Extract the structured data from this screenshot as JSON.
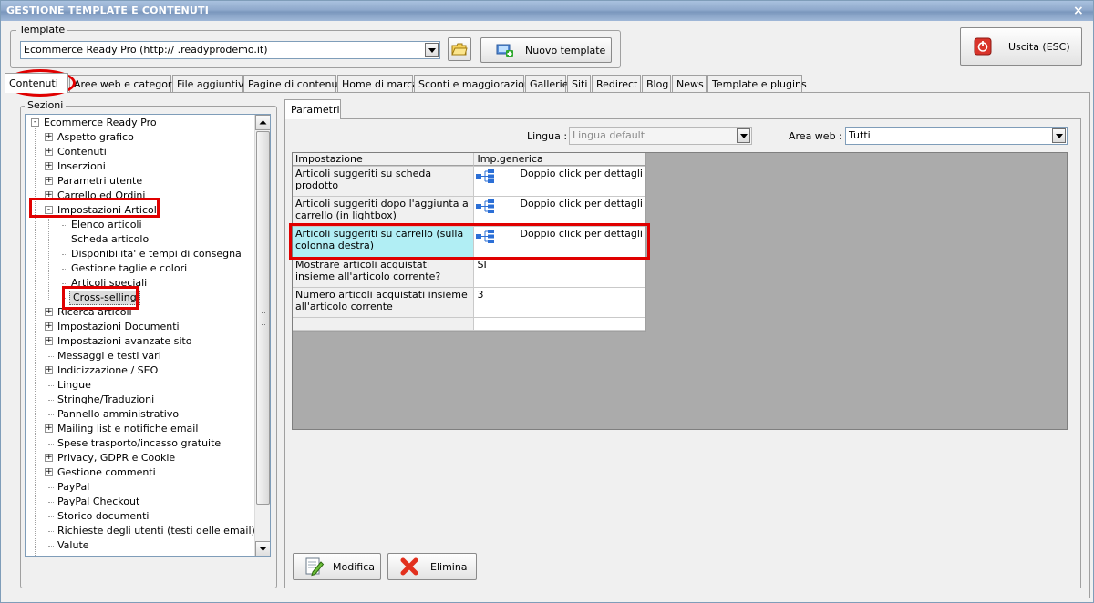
{
  "window": {
    "title": "GESTIONE TEMPLATE E CONTENUTI",
    "close_glyph": "×"
  },
  "template_group": {
    "label": "Template",
    "selected": "Ecommerce Ready Pro (http://     .readyprodemo.it)",
    "new_template_label": "Nuovo template"
  },
  "exit_button": {
    "label": "Uscita (ESC)"
  },
  "tabs": [
    {
      "label": "Contenuti",
      "active": true
    },
    {
      "label": "Aree web e categorie"
    },
    {
      "label": "File aggiuntivi"
    },
    {
      "label": "Pagine di contenuti"
    },
    {
      "label": "Home di marca"
    },
    {
      "label": "Sconti e maggiorazioni"
    },
    {
      "label": "Gallerie"
    },
    {
      "label": "Siti"
    },
    {
      "label": "Redirect"
    },
    {
      "label": "Blog"
    },
    {
      "label": "News"
    },
    {
      "label": "Template e plugins"
    }
  ],
  "sections": {
    "label": "Sezioni",
    "tree": [
      {
        "label": "Ecommerce Ready Pro",
        "level": 0,
        "expander": "-"
      },
      {
        "label": "Aspetto grafico",
        "level": 1,
        "expander": "+"
      },
      {
        "label": "Contenuti",
        "level": 1,
        "expander": "+"
      },
      {
        "label": "Inserzioni",
        "level": 1,
        "expander": "+"
      },
      {
        "label": "Parametri utente",
        "level": 1,
        "expander": "+"
      },
      {
        "label": "Carrello ed Ordini",
        "level": 1,
        "expander": "+"
      },
      {
        "label": "Impostazioni Articoli",
        "level": 1,
        "expander": "-"
      },
      {
        "label": "Elenco articoli",
        "level": 2
      },
      {
        "label": "Scheda articolo",
        "level": 2
      },
      {
        "label": "Disponibilita' e tempi di consegna",
        "level": 2
      },
      {
        "label": "Gestione taglie e colori",
        "level": 2
      },
      {
        "label": "Articoli speciali",
        "level": 2
      },
      {
        "label": "Cross-selling",
        "level": 2,
        "selected": true
      },
      {
        "label": "Ricerca articoli",
        "level": 1,
        "expander": "+"
      },
      {
        "label": "Impostazioni Documenti",
        "level": 1,
        "expander": "+"
      },
      {
        "label": "Impostazioni avanzate sito",
        "level": 1,
        "expander": "+"
      },
      {
        "label": "Messaggi e testi vari",
        "level": 1
      },
      {
        "label": "Indicizzazione / SEO",
        "level": 1,
        "expander": "+"
      },
      {
        "label": "Lingue",
        "level": 1
      },
      {
        "label": "Stringhe/Traduzioni",
        "level": 1
      },
      {
        "label": "Pannello amministrativo",
        "level": 1
      },
      {
        "label": "Mailing list e notifiche email",
        "level": 1,
        "expander": "+"
      },
      {
        "label": "Spese trasporto/incasso gratuite",
        "level": 1
      },
      {
        "label": "Privacy, GDPR e Cookie",
        "level": 1,
        "expander": "+"
      },
      {
        "label": "Gestione commenti",
        "level": 1,
        "expander": "+"
      },
      {
        "label": "PayPal",
        "level": 1
      },
      {
        "label": "PayPal Checkout",
        "level": 1
      },
      {
        "label": "Storico documenti",
        "level": 1
      },
      {
        "label": "Richieste degli utenti (testi delle email)",
        "level": 1
      },
      {
        "label": "Valute",
        "level": 1
      }
    ]
  },
  "params": {
    "tab_label": "Parametri",
    "lingua_label": "Lingua :",
    "lingua_value": "Lingua default",
    "area_label": "Area web :",
    "area_value": "Tutti",
    "columns": [
      "Impostazione",
      "Imp.generica"
    ],
    "rows": [
      {
        "setting": "Articoli suggeriti su scheda prodotto",
        "value": "Doppio click per dettagli",
        "icon": true
      },
      {
        "setting": "Articoli suggeriti dopo l'aggiunta a carrello (in lightbox)",
        "value": "Doppio click per dettagli",
        "icon": true
      },
      {
        "setting": "Articoli suggeriti su carrello (sulla colonna destra)",
        "value": "Doppio click per dettagli",
        "icon": true,
        "selected": true
      },
      {
        "setting": "Mostrare articoli acquistati insieme all'articolo corrente?",
        "value": "SI"
      },
      {
        "setting": "Numero articoli acquistati insieme all'articolo corrente",
        "value": "3"
      },
      {
        "setting": "",
        "value": ""
      }
    ]
  },
  "actions": {
    "modify_label": "Modifica",
    "delete_label": "Elimina"
  },
  "colors": {
    "annotation": "#e00000",
    "selected_row": "#b1eef4",
    "titlebar": "#8fa9cc"
  }
}
